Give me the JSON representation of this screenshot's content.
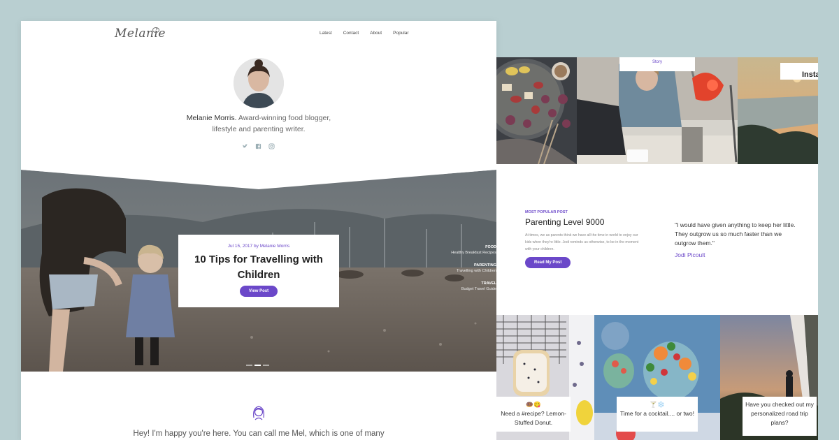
{
  "brand": {
    "logo_text": "Melanie"
  },
  "nav": {
    "items": [
      "Latest",
      "Contact",
      "About",
      "Popular"
    ]
  },
  "profile": {
    "name": "Melanie Morris.",
    "bio_line1": "Award-winning food blogger,",
    "bio_line2": "lifestyle and parenting writer.",
    "social_icons": [
      "twitter-icon",
      "facebook-icon",
      "instagram-icon"
    ]
  },
  "hero": {
    "meta": "Jul 15, 2017 by Melanie Morris",
    "title": "10 Tips for Travelling with Children",
    "button_label": "View Post",
    "side_categories": [
      {
        "category": "FOOD",
        "post": "Healthy Breakfast Recipes"
      },
      {
        "category": "PARENTING",
        "post": "Travelling with Children"
      },
      {
        "category": "TRAVEL",
        "post": "Budget Travel Guide"
      }
    ],
    "slider_active": 2
  },
  "intro": {
    "text": "Hey! I'm happy you're here. You can call me Mel, which is one of many"
  },
  "right": {
    "tiles_top": {
      "story_label": "Story",
      "insta_label": "Insta"
    },
    "most_popular": {
      "label": "MOST POPULAR POST",
      "title": "Parenting Level 9000",
      "excerpt": "At times, we as parents think we have all the time in world to enjoy our kids when they're little. Jodi reminds us otherwise, to be in the moment with your children.",
      "button_label": "Read My Post"
    },
    "quote": {
      "text": "\"I would have given anything to keep her little. They outgrow us so much faster than we outgrow them.\"",
      "author": "Jodi Picoult"
    },
    "captions": [
      {
        "emoji": "🍩😋",
        "text": "Need a #recipe? Lemon-Stuffed Donut."
      },
      {
        "emoji": "🍸❄️",
        "text": "Time for a cocktail.... or two!"
      },
      {
        "emoji": "",
        "text": "Have you checked out my personalized road trip plans?"
      }
    ]
  },
  "colors": {
    "accent": "#6b48c9",
    "background": "#b9cfd1"
  }
}
